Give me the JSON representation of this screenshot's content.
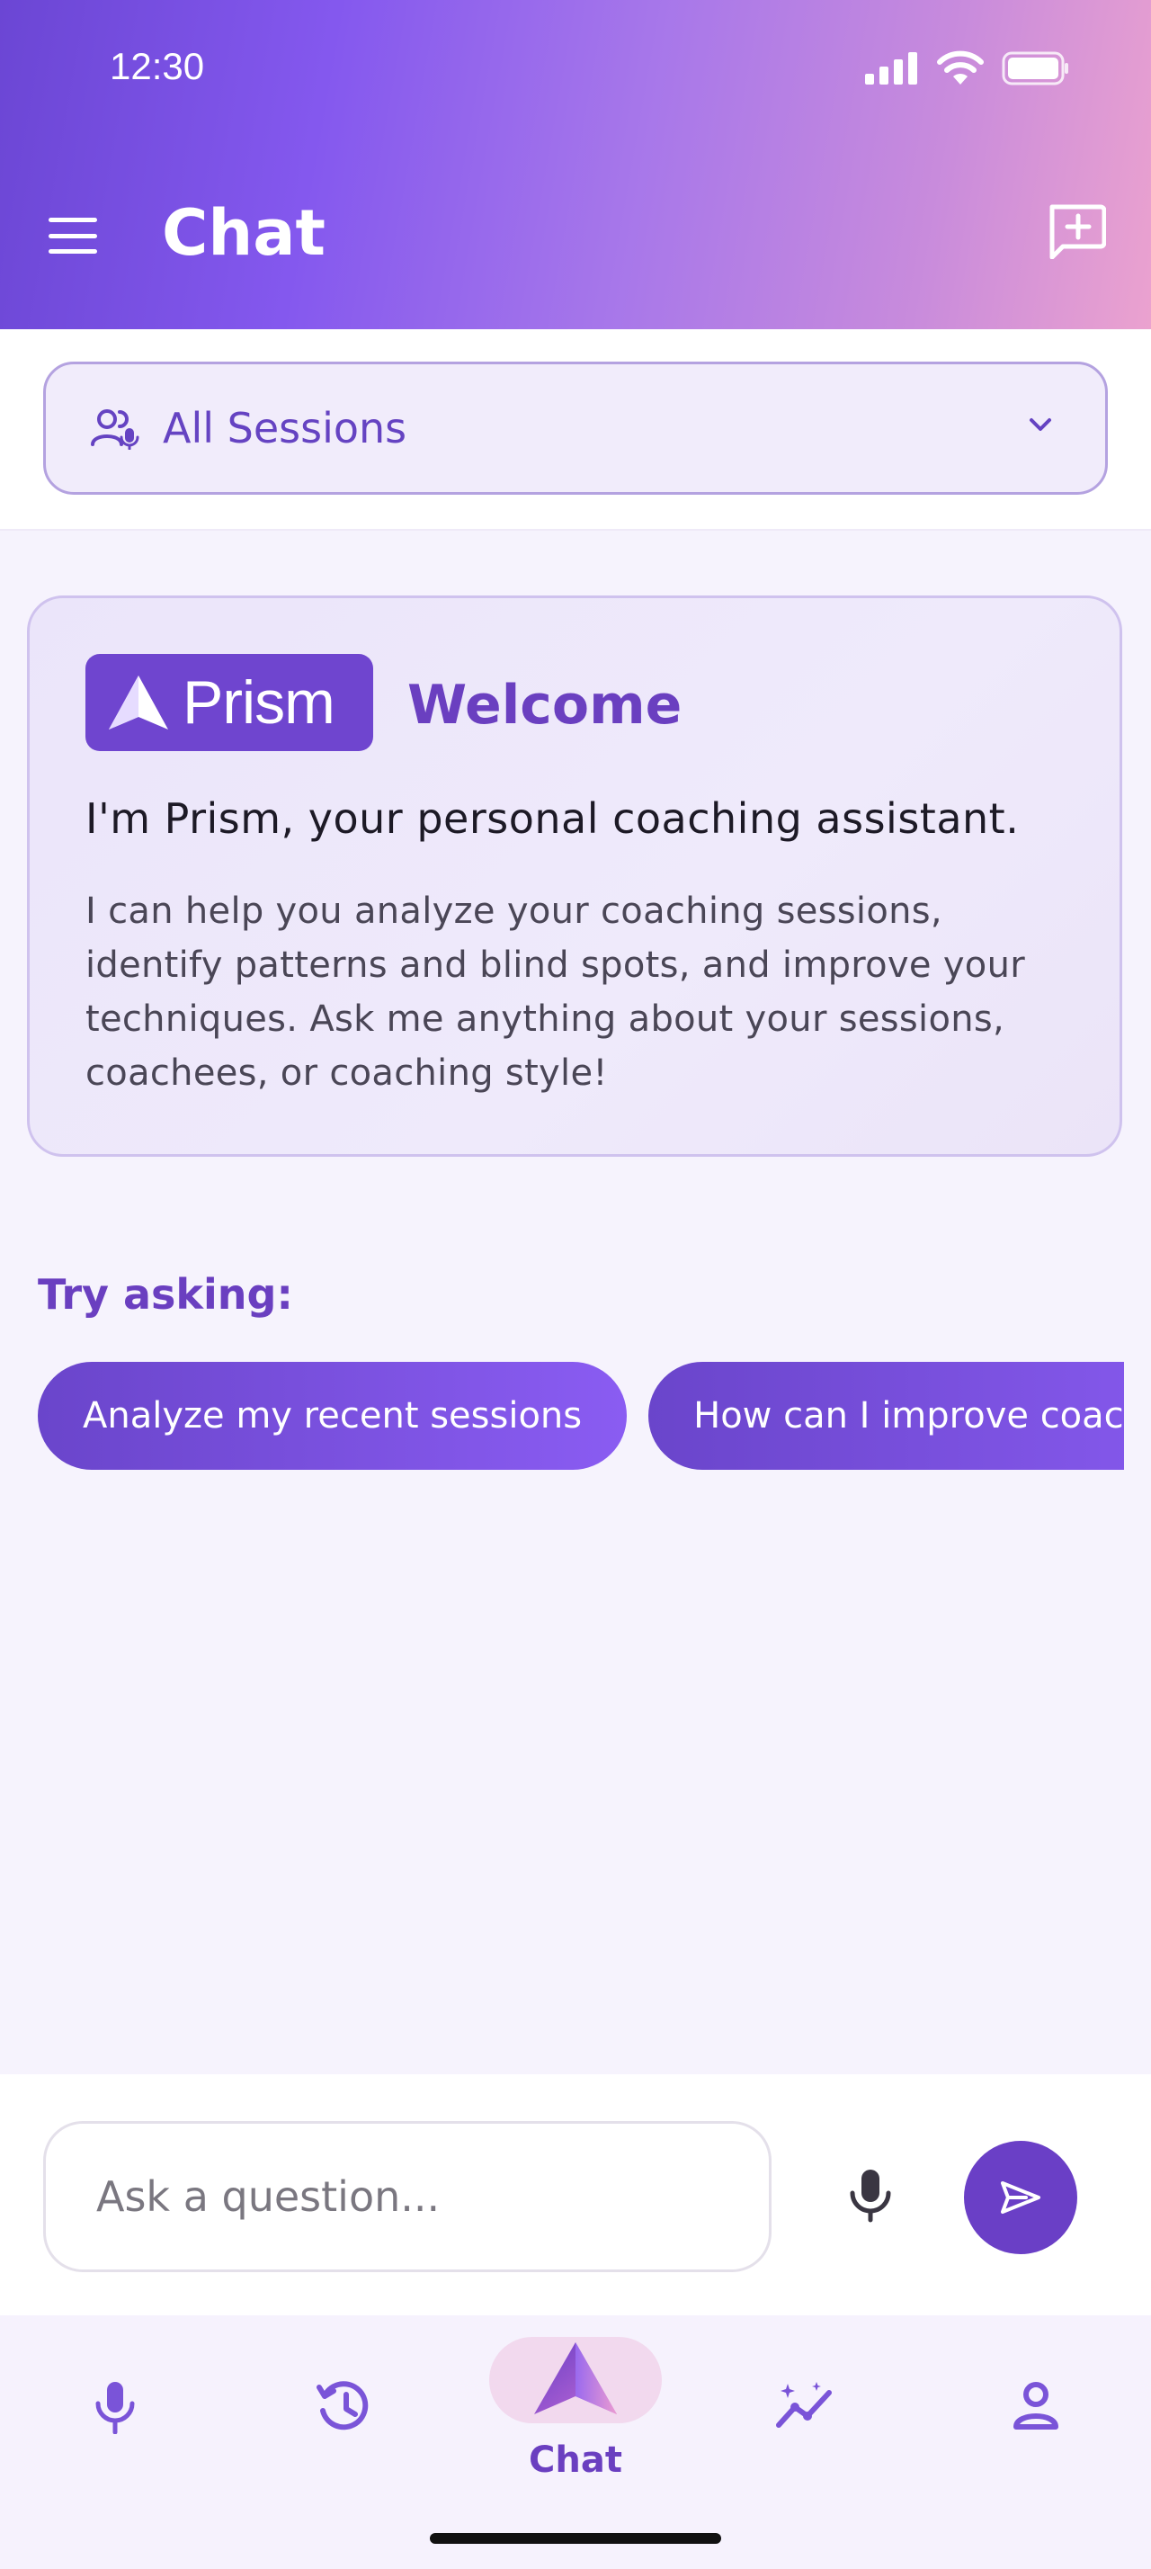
{
  "status_bar": {
    "time": "12:30"
  },
  "header": {
    "title": "Chat"
  },
  "session_selector": {
    "label": "All Sessions"
  },
  "welcome": {
    "logo_text": "Prism",
    "title": "Welcome",
    "subtitle": "I'm Prism, your personal coaching assistant.",
    "body": "I can help you analyze your coaching sessions, identify patterns and blind spots, and improve your techniques. Ask me anything about your sessions, coachees, or coaching style!"
  },
  "suggestions": {
    "label": "Try asking:",
    "items": [
      {
        "label": "Analyze my recent sessions"
      },
      {
        "label": "How can I improve coaching?"
      }
    ]
  },
  "composer": {
    "placeholder": "Ask a question..."
  },
  "bottom_nav": {
    "active_label": "Chat",
    "items": [
      {
        "icon": "mic-icon"
      },
      {
        "icon": "history-icon"
      },
      {
        "icon": "prism-logo-icon"
      },
      {
        "icon": "insights-icon"
      },
      {
        "icon": "person-icon"
      }
    ]
  },
  "colors": {
    "accent": "#6a3fc0",
    "header_gradient_start": "#6b46d4",
    "header_gradient_end": "#eba2cf",
    "background": "#f6f3fd"
  }
}
